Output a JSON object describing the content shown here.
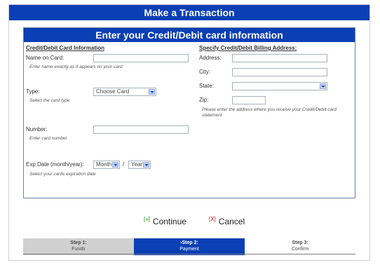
{
  "header": {
    "title": "Make a Transaction"
  },
  "panel": {
    "title": "Enter your Credit/Debit card information"
  },
  "card_info": {
    "section_title": "Credit/Debit Card Information",
    "name_label": "Name on Card:",
    "name_hint": "Enter name exactly as it appears on your card",
    "type_label": "Type:",
    "type_value": "Choose Card",
    "type_hint": "Select the card type",
    "number_label": "Number:",
    "number_hint": "Enter card number",
    "exp_label": "Exp Date (month/year):",
    "month_value": "Month",
    "slash": "/",
    "year_value": "Year",
    "exp_hint": "Select your cards expiration date"
  },
  "billing": {
    "section_title": "Specify Credit/Debit Billing Address:",
    "address_label": "Address:",
    "city_label": "City:",
    "state_label": "State:",
    "state_value": "",
    "zip_label": "Zip:",
    "address_hint": "Please enter the address where you receive your Credit/Debit card statement"
  },
  "actions": {
    "continue_tag": "[»]",
    "continue_label": "Continue",
    "cancel_tag": "[X]",
    "cancel_label": "Cancel"
  },
  "steps": [
    {
      "number": "Step 1:",
      "name": "Funds",
      "active": false
    },
    {
      "number": "›Step 2:",
      "name": "Payment",
      "active": true
    },
    {
      "number": "Step 3:",
      "name": "Confirm",
      "active": false
    }
  ],
  "colors": {
    "brand_blue": "#0a3fb5",
    "step_inactive_bg": "#d0d0d0",
    "step_active_bg": "#0a3fb5",
    "step_text": "#4a4a4a",
    "step_active_text": "#ffffff"
  },
  "icons": {
    "select_arrow": "chevron-down-icon",
    "continue": "continue-arrow-icon",
    "cancel": "cancel-x-icon"
  }
}
